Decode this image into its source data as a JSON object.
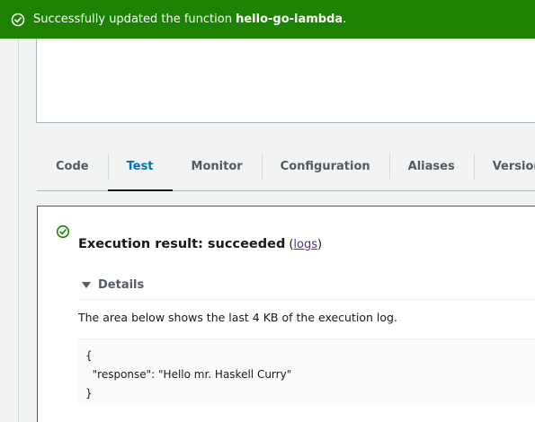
{
  "flash": {
    "prefix": "Successfully updated the function ",
    "function_name": "hello-go-lambda",
    "suffix": "."
  },
  "tabs": [
    {
      "label": "Code",
      "active": false
    },
    {
      "label": "Test",
      "active": true
    },
    {
      "label": "Monitor",
      "active": false
    },
    {
      "label": "Configuration",
      "active": false
    },
    {
      "label": "Aliases",
      "active": false
    },
    {
      "label": "Versions",
      "active": false
    }
  ],
  "result": {
    "heading": "Execution result: succeeded",
    "paren_open": "(",
    "logs_link": "logs",
    "paren_close": ")",
    "details_label": "Details",
    "description": "The area below shows the last 4 KB of the execution log.",
    "log_lines": [
      "{",
      "  \"response\": \"Hello mr. Haskell Curry\"",
      "}"
    ]
  },
  "colors": {
    "success": "#1d8102",
    "active_tab": "#0073bb",
    "link": "#5a2ca0"
  }
}
